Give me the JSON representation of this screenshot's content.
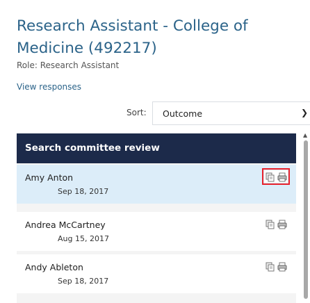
{
  "job": {
    "title": "Research Assistant - College of Medicine (492217)",
    "role": "Role: Research Assistant",
    "view_responses": "View responses"
  },
  "sort": {
    "label": "Sort:",
    "value": "Outcome"
  },
  "panel": {
    "title": "Search committee review",
    "rows": [
      {
        "name": "Amy Anton",
        "date": "Sep 18, 2017",
        "selected": true
      },
      {
        "name": "Andrea McCartney",
        "date": "Aug 15, 2017",
        "selected": false
      },
      {
        "name": "Andy Ableton",
        "date": "Sep 18, 2017",
        "selected": false
      }
    ]
  },
  "icons": [
    "copy-icon",
    "print-icon",
    "chevron-down-icon",
    "scroll-up-icon"
  ],
  "colors": {
    "title": "#2b6389",
    "header_bg": "#1c2a4a",
    "selected_row": "#dcedf9",
    "highlight_box": "#e8202a"
  }
}
